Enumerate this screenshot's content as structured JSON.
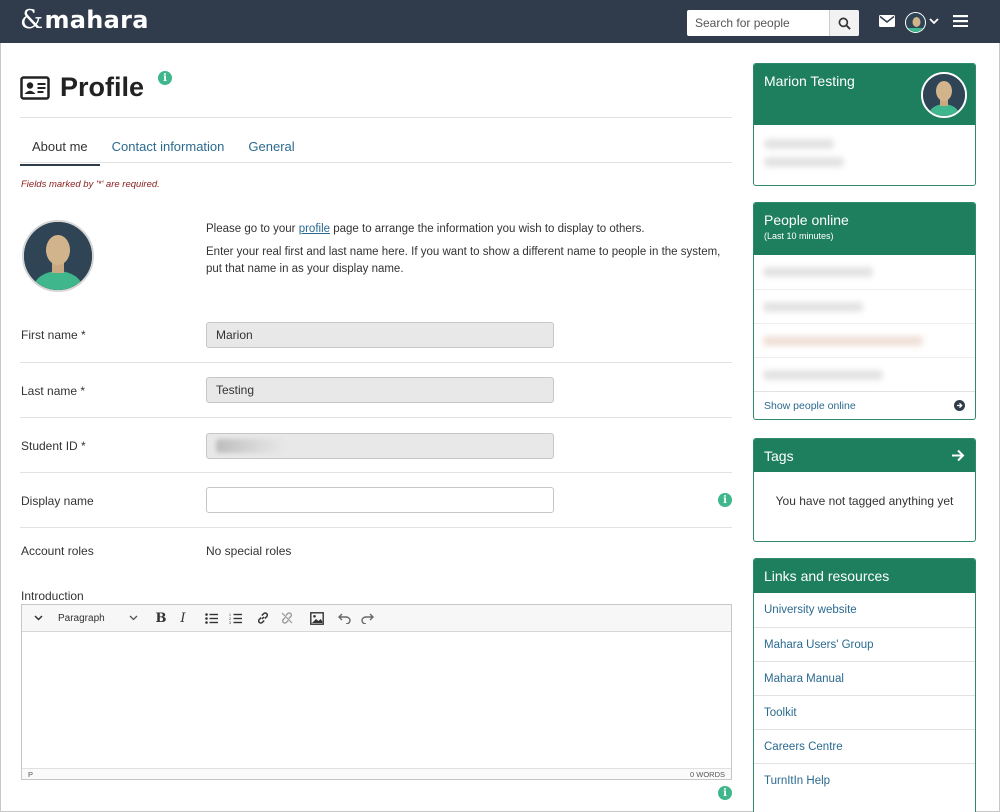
{
  "header": {
    "logo_text": "mahara",
    "search_placeholder": "Search for people",
    "icons": [
      "search-icon",
      "envelope-icon",
      "avatar",
      "chevron-down-icon",
      "hamburger-icon"
    ]
  },
  "page": {
    "title": "Profile",
    "tabs": [
      {
        "label": "About me",
        "active": true
      },
      {
        "label": "Contact information",
        "active": false
      },
      {
        "label": "General",
        "active": false
      }
    ],
    "required_note": "Fields marked by '*' are required.",
    "intro_pre": "Please go to your ",
    "intro_link": "profile",
    "intro_post": " page to arrange the information you wish to display to others.",
    "intro_second": "Enter your real first and last name here. If you want to show a different name to people in the system, put that name in as your display name."
  },
  "form": {
    "first_name_label": "First name *",
    "first_name_value": "Marion",
    "last_name_label": "Last name *",
    "last_name_value": "Testing",
    "student_id_label": "Student ID *",
    "display_name_label": "Display name",
    "display_name_value": "",
    "account_roles_label": "Account roles",
    "account_roles_value": "No special roles",
    "introduction_label": "Introduction"
  },
  "editor": {
    "block_format": "Paragraph",
    "toolbar_icons": [
      "chevron-down-icon",
      "bold-icon",
      "italic-icon",
      "bullet-list-icon",
      "numbered-list-icon",
      "link-icon",
      "unlink-icon",
      "image-icon",
      "undo-icon",
      "redo-icon"
    ],
    "status_left": "P",
    "status_right": "0 WORDS"
  },
  "sidebar": {
    "profile_block": {
      "name": "Marion Testing"
    },
    "people_online": {
      "title": "People online",
      "subtitle": "(Last 10 minutes)",
      "footer_link": "Show people online"
    },
    "tags": {
      "title": "Tags",
      "empty_text": "You have not tagged anything yet"
    },
    "links": {
      "title": "Links and resources",
      "items": [
        "University website",
        "Mahara Users' Group",
        "Mahara Manual",
        "Toolkit",
        "Careers Centre",
        "TurnItIn Help"
      ]
    }
  },
  "colors": {
    "header_bg": "#303c4c",
    "accent_green": "#1e7f5e",
    "link_blue": "#2b6a8f",
    "info_green": "#3fb68b",
    "required_red": "#8b2020"
  }
}
